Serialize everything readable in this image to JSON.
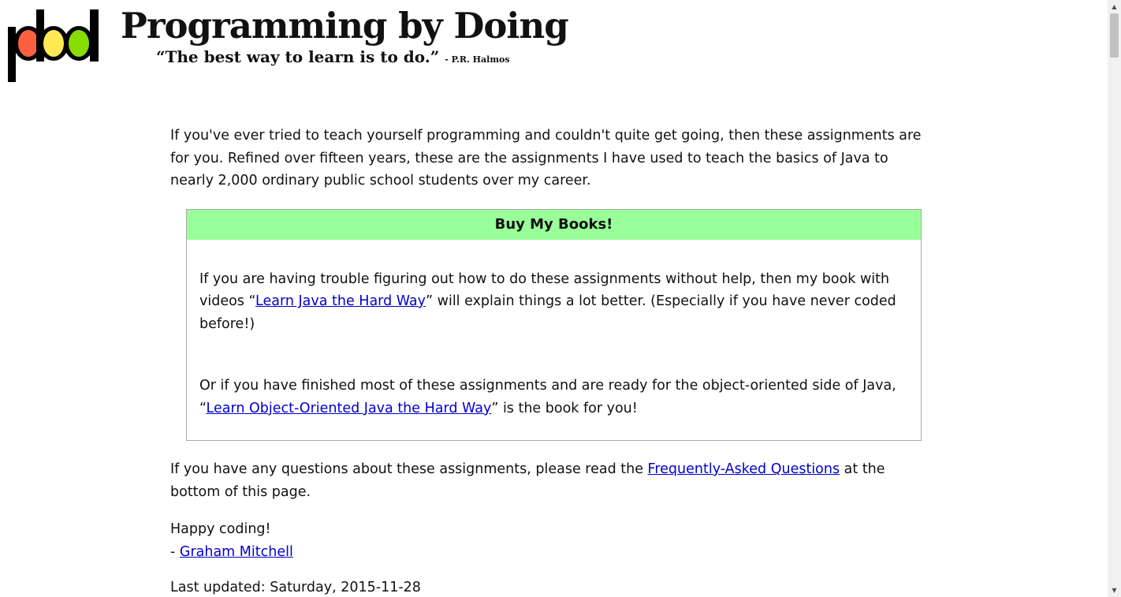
{
  "header": {
    "site_title": "Programming by Doing",
    "tagline_quote": "“The best way to learn is to do.”",
    "tagline_attribution": "- P.R. Halmos",
    "logo_icon": "pbd-logo",
    "logo_colors": [
      "#ff6040",
      "#ffea55",
      "#88dd00"
    ]
  },
  "intro": {
    "text": "If you've ever tried to teach yourself programming and couldn't quite get going, then these assignments are for you. Refined over fifteen years, these are the assignments I have used to teach the basics of Java to nearly 2,000 ordinary public school students over my career."
  },
  "books_box": {
    "header": "Buy My Books!",
    "header_color": "#99ff99",
    "p1_before": "If you are having trouble figuring out how to do these assignments without help, then my book with videos “",
    "p1_link": "Learn Java the Hard Way",
    "p1_after": "” will explain things a lot better. (Especially if you have never coded before!)",
    "p2_before": "Or if you have finished most of these assignments and are ready for the object-oriented side of Java, “",
    "p2_link": "Learn Object-Oriented Java the Hard Way",
    "p2_after": "” is the book for you!"
  },
  "faq": {
    "before": "If you have any questions about these assignments, please read the ",
    "link": "Frequently-Asked Questions",
    "after": " at the bottom of this page."
  },
  "closing": {
    "greeting": "Happy coding!",
    "dash": "- ",
    "author_link": "Graham Mitchell"
  },
  "last_updated": "Last updated: Saturday, 2015-11-28",
  "link_color": "#0000cc"
}
